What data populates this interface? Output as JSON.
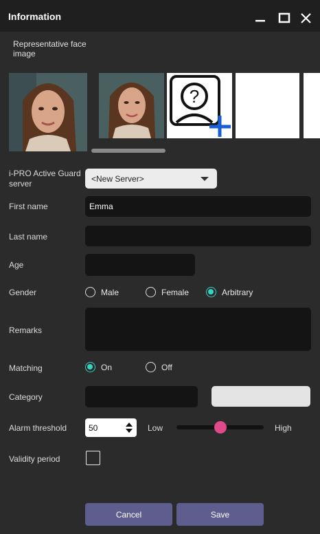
{
  "window": {
    "title": "Information"
  },
  "face": {
    "label": "Representative face image",
    "thumbs": [
      "face-photo-main",
      "face-photo-2",
      "add-face-icon",
      "empty-slot",
      "empty-slot"
    ]
  },
  "server": {
    "label": "i-PRO Active Guard server",
    "selected": "<New Server>"
  },
  "first_name": {
    "label": "First name",
    "value": "Emma"
  },
  "last_name": {
    "label": "Last name",
    "value": ""
  },
  "age": {
    "label": "Age",
    "value": ""
  },
  "gender": {
    "label": "Gender",
    "options": [
      "Male",
      "Female",
      "Arbitrary"
    ],
    "selected": "Arbitrary"
  },
  "remarks": {
    "label": "Remarks",
    "value": ""
  },
  "matching": {
    "label": "Matching",
    "options": [
      "On",
      "Off"
    ],
    "selected": "On"
  },
  "category": {
    "label": "Category",
    "value": ""
  },
  "alarm": {
    "label": "Alarm threshold",
    "value": "50",
    "low": "Low",
    "high": "High",
    "slider_fraction": 0.5
  },
  "validity": {
    "label": "Validity period",
    "checked": false
  },
  "buttons": {
    "cancel": "Cancel",
    "save": "Save"
  },
  "colors": {
    "accent": "#39d1c0",
    "slider_knob": "#e0498a",
    "button": "#5d5e8e",
    "add_plus": "#1a5fd6"
  }
}
